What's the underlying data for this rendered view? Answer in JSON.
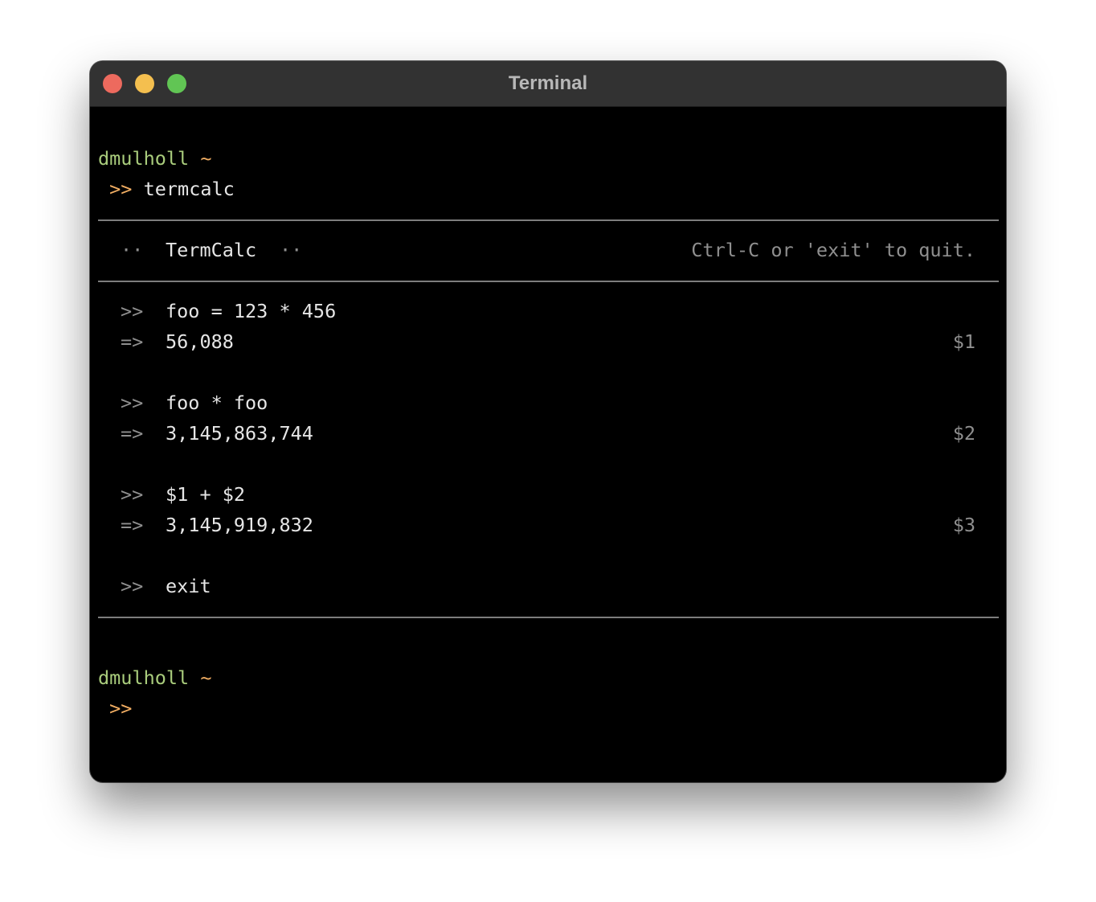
{
  "window": {
    "title": "Terminal"
  },
  "shell": {
    "user": "dmulholl",
    "cwd": "~",
    "prompt": ">>",
    "command": "termcalc"
  },
  "termcalc": {
    "header_left_dots": "··",
    "header_title": "TermCalc",
    "header_right_dots": "··",
    "quit_hint": "Ctrl-C or 'exit' to quit.",
    "input_marker": ">>",
    "output_marker": "=>",
    "entries": [
      {
        "input": "foo = 123 * 456",
        "output": "56,088",
        "ref": "$1"
      },
      {
        "input": "foo * foo",
        "output": "3,145,863,744",
        "ref": "$2"
      },
      {
        "input": "$1 + $2",
        "output": "3,145,919,832",
        "ref": "$3"
      }
    ],
    "last_input": "exit"
  },
  "colors": {
    "username": "#a9cc7c",
    "prompt": "#f2ae63",
    "muted": "#8f8f8f",
    "text": "#e6e6e6",
    "background": "#000000",
    "titlebar": "#323232"
  },
  "icons": [
    "close-icon",
    "minimize-icon",
    "zoom-icon"
  ]
}
